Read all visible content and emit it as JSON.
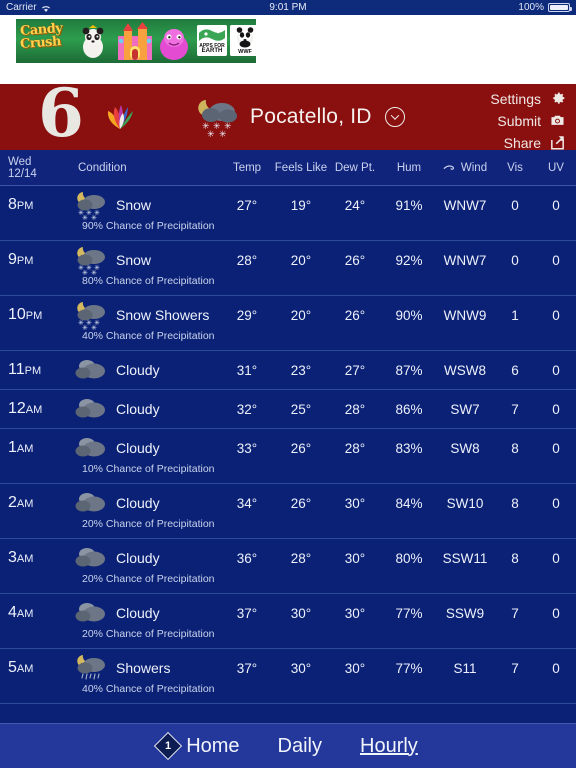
{
  "status_bar": {
    "carrier": "Carrier",
    "wifi_icon": "wifi-icon",
    "time": "9:01 PM",
    "battery_percent": "100%"
  },
  "ad": {
    "name": "candy-crush-banner",
    "title_line1": "Candy",
    "title_line2": "Crush",
    "badge1": "APPS FOR EARTH",
    "badge2": "WWF"
  },
  "header": {
    "logo_digit": "6",
    "location": "Pocatello, ID",
    "location_icon": "moon-cloud-snow-icon",
    "menu": [
      {
        "label": "Settings",
        "icon": "gear-icon"
      },
      {
        "label": "Submit",
        "icon": "camera-icon"
      },
      {
        "label": "Share",
        "icon": "share-icon"
      }
    ]
  },
  "table": {
    "headers": {
      "day": "Wed",
      "date": "12/14",
      "condition": "Condition",
      "temp": "Temp",
      "feels_like": "Feels Like",
      "dew_point": "Dew Pt.",
      "humidity": "Hum",
      "wind": "Wind",
      "wind_icon": "wind-icon",
      "visibility": "Vis",
      "uv": "UV"
    },
    "rows": [
      {
        "time_num": "8",
        "time_ampm": "PM",
        "icon": "moon-cloud-snow-icon",
        "condition": "Snow",
        "precip": "90% Chance of Precipitation",
        "temp": "27°",
        "feels_like": "19°",
        "dew_point": "24°",
        "humidity": "91%",
        "wind": "WNW7",
        "vis": "0",
        "uv": "0"
      },
      {
        "time_num": "9",
        "time_ampm": "PM",
        "icon": "moon-cloud-snow-icon",
        "condition": "Snow",
        "precip": "80% Chance of Precipitation",
        "temp": "28°",
        "feels_like": "20°",
        "dew_point": "26°",
        "humidity": "92%",
        "wind": "WNW7",
        "vis": "0",
        "uv": "0"
      },
      {
        "time_num": "10",
        "time_ampm": "PM",
        "icon": "moon-cloud-snow-icon",
        "condition": "Snow Showers",
        "precip": "40% Chance of Precipitation",
        "temp": "29°",
        "feels_like": "20°",
        "dew_point": "26°",
        "humidity": "90%",
        "wind": "WNW9",
        "vis": "1",
        "uv": "0"
      },
      {
        "time_num": "11",
        "time_ampm": "PM",
        "icon": "cloudy-icon",
        "condition": "Cloudy",
        "precip": "",
        "temp": "31°",
        "feels_like": "23°",
        "dew_point": "27°",
        "humidity": "87%",
        "wind": "WSW8",
        "vis": "6",
        "uv": "0"
      },
      {
        "time_num": "12",
        "time_ampm": "AM",
        "icon": "cloudy-icon",
        "condition": "Cloudy",
        "precip": "",
        "temp": "32°",
        "feels_like": "25°",
        "dew_point": "28°",
        "humidity": "86%",
        "wind": "SW7",
        "vis": "7",
        "uv": "0"
      },
      {
        "time_num": "1",
        "time_ampm": "AM",
        "icon": "cloudy-icon",
        "condition": "Cloudy",
        "precip": "10% Chance of Precipitation",
        "temp": "33°",
        "feels_like": "26°",
        "dew_point": "28°",
        "humidity": "83%",
        "wind": "SW8",
        "vis": "8",
        "uv": "0"
      },
      {
        "time_num": "2",
        "time_ampm": "AM",
        "icon": "cloudy-icon",
        "condition": "Cloudy",
        "precip": "20% Chance of Precipitation",
        "temp": "34°",
        "feels_like": "26°",
        "dew_point": "30°",
        "humidity": "84%",
        "wind": "SW10",
        "vis": "8",
        "uv": "0"
      },
      {
        "time_num": "3",
        "time_ampm": "AM",
        "icon": "cloudy-icon",
        "condition": "Cloudy",
        "precip": "20% Chance of Precipitation",
        "temp": "36°",
        "feels_like": "28°",
        "dew_point": "30°",
        "humidity": "80%",
        "wind": "SSW11",
        "vis": "8",
        "uv": "0"
      },
      {
        "time_num": "4",
        "time_ampm": "AM",
        "icon": "cloudy-icon",
        "condition": "Cloudy",
        "precip": "20% Chance of Precipitation",
        "temp": "37°",
        "feels_like": "30°",
        "dew_point": "30°",
        "humidity": "77%",
        "wind": "SSW9",
        "vis": "7",
        "uv": "0"
      },
      {
        "time_num": "5",
        "time_ampm": "AM",
        "icon": "moon-cloud-rain-icon",
        "condition": "Showers",
        "precip": "40% Chance of Precipitation",
        "temp": "37°",
        "feels_like": "30°",
        "dew_point": "30°",
        "humidity": "77%",
        "wind": "S11",
        "vis": "7",
        "uv": "0"
      }
    ]
  },
  "tabbar": {
    "home": "Home",
    "home_badge": "1",
    "daily": "Daily",
    "hourly": "Hourly"
  },
  "colors": {
    "brand_red": "#8a0f0f",
    "background_navy": "#0a2175",
    "header_navy": "#11247c",
    "tabbar_navy": "#24389b",
    "divider": "#2d4a96"
  }
}
